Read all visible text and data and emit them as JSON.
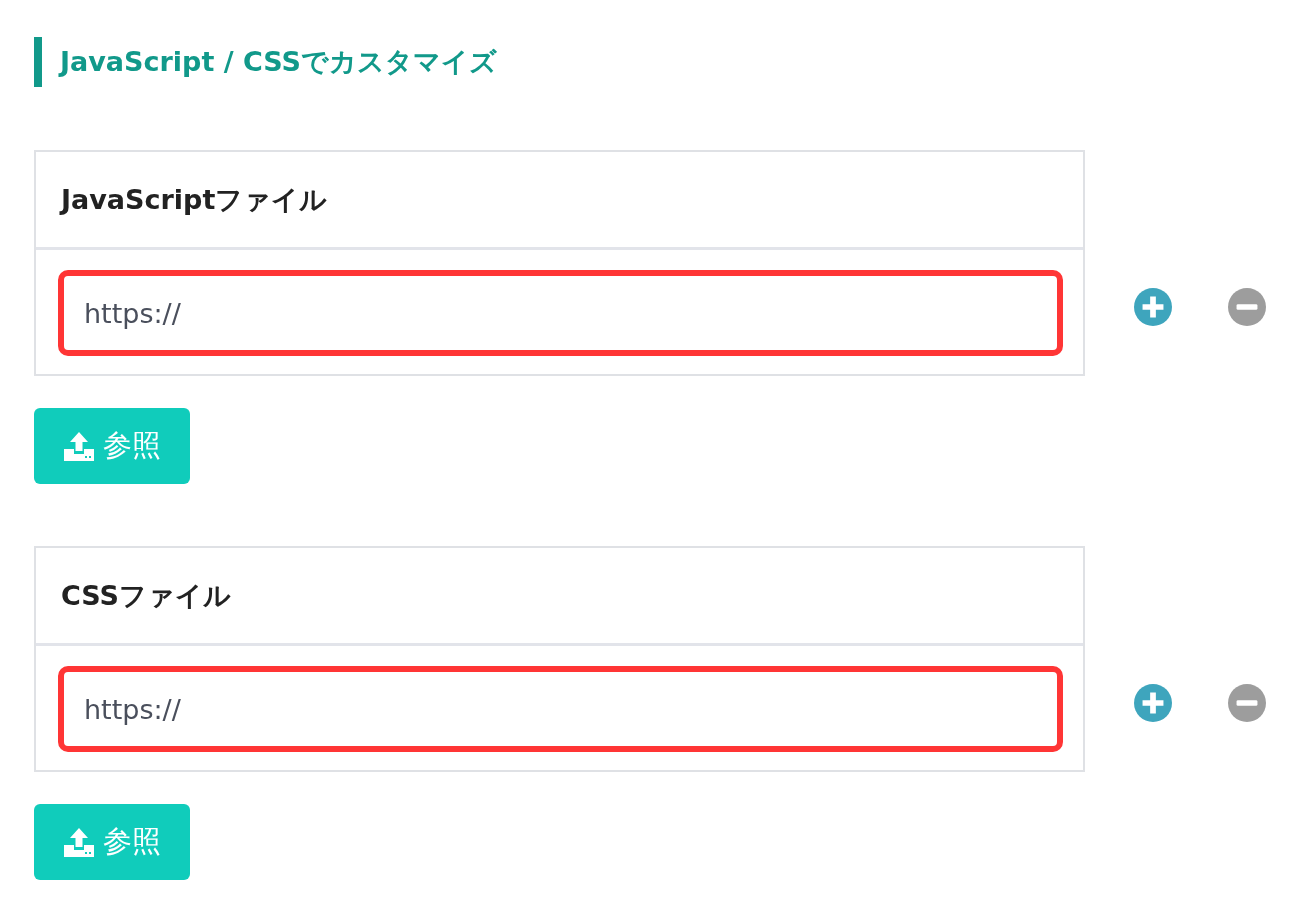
{
  "heading": "JavaScript / CSSでカスタマイズ",
  "sections": [
    {
      "title": "JavaScriptファイル",
      "field": {
        "value": "https://",
        "highlighted": true
      },
      "button": "参照"
    },
    {
      "title": "CSSファイル",
      "field": {
        "value": "https://",
        "highlighted": true
      },
      "button": "参照"
    }
  ]
}
